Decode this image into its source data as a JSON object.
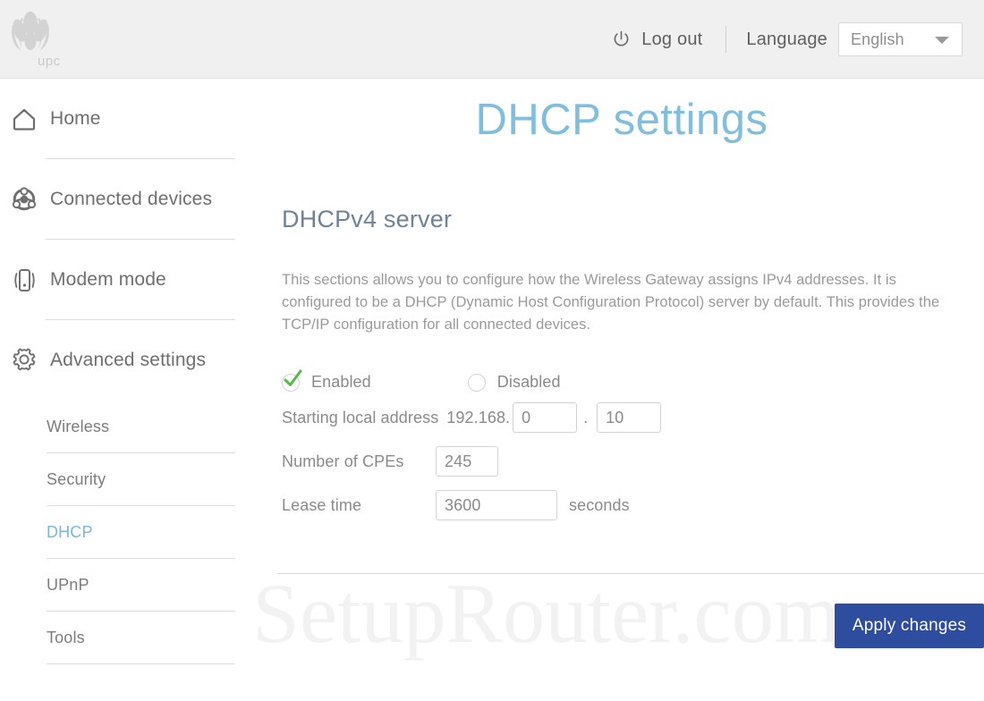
{
  "header": {
    "brand_name": "upc",
    "brand_icon": "lotus-logo-icon",
    "logout_icon": "power-icon",
    "logout_label": "Log out",
    "language_label": "Language",
    "language_value": "English",
    "language_caret_icon": "chevron-down-icon"
  },
  "sidebar": {
    "main_items": [
      {
        "label": "Home",
        "icon": "house-icon"
      },
      {
        "label": "Connected devices",
        "icon": "network-devices-icon"
      },
      {
        "label": "Modem mode",
        "icon": "modem-icon"
      },
      {
        "label": "Advanced settings",
        "icon": "gear-icon"
      }
    ],
    "sub_items": [
      {
        "label": "Wireless",
        "active": false
      },
      {
        "label": "Security",
        "active": false
      },
      {
        "label": "DHCP",
        "active": true
      },
      {
        "label": "UPnP",
        "active": false
      },
      {
        "label": "Tools",
        "active": false
      }
    ]
  },
  "main": {
    "page_title": "DHCP settings",
    "section_title": "DHCPv4 server",
    "description": "This sections allows you to configure how the Wireless Gateway assigns IPv4 addresses. It is configured to be a DHCP (Dynamic Host Configuration Protocol) server by default. This provides the TCP/IP configuration for all connected devices.",
    "server_state": {
      "enabled_label": "Enabled",
      "disabled_label": "Disabled",
      "selected": "Enabled",
      "enabled_icon": "green-check-icon",
      "disabled_icon": "empty-radio-icon"
    },
    "fields": {
      "starting_address_label": "Starting local address",
      "starting_address_prefix": "192.168.",
      "starting_address_octet3": "0",
      "starting_address_separator": ".",
      "starting_address_octet4": "10",
      "number_of_cpes_label": "Number of CPEs",
      "number_of_cpes_value": "245",
      "lease_time_label": "Lease time",
      "lease_time_value": "3600",
      "lease_time_unit": "seconds"
    },
    "apply_button_label": "Apply changes",
    "watermark_text": "SetupRouter.com"
  },
  "colors": {
    "accent_blue": "#7fbedd",
    "button_blue": "#2e4d9e",
    "section_heading": "#6f8296",
    "check_green": "#57b847",
    "header_bg": "#f0f0f0"
  }
}
